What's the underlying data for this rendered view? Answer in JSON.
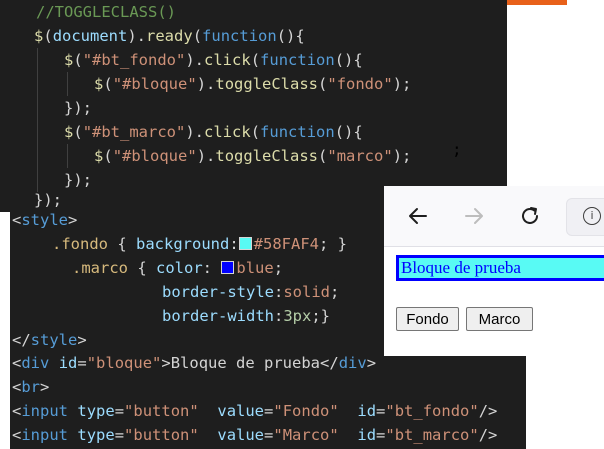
{
  "js_code": {
    "comment": "//TOGGLECLASS()",
    "line1": {
      "a": "$",
      "b": "(",
      "c": "document",
      "d": ").",
      "e": "ready",
      "f": "(",
      "g": "function",
      "h": "(){"
    },
    "line2": {
      "a": "$",
      "b": "(",
      "c": "\"#bt_fondo\"",
      "d": ").",
      "e": "click",
      "f": "(",
      "g": "function",
      "h": "(){"
    },
    "line3": {
      "a": "$",
      "b": "(",
      "c": "\"#bloque\"",
      "d": ").",
      "e": "toggleClass",
      "f": "(",
      "g": "\"fondo\"",
      "h": ");"
    },
    "line4": "});",
    "line5": {
      "a": "$",
      "b": "(",
      "c": "\"#bt_marco\"",
      "d": ").",
      "e": "click",
      "f": "(",
      "g": "function",
      "h": "(){"
    },
    "line6": {
      "a": "$",
      "b": "(",
      "c": "\"#bloque\"",
      "d": ").",
      "e": "toggleClass",
      "f": "(",
      "g": "\"marco\"",
      "h": ");"
    },
    "line7": "});",
    "line8": "});"
  },
  "stray_semicolon": ";",
  "css_code": {
    "open_tag": "style",
    "fondo_sel": ".fondo",
    "fondo_open": " { ",
    "fondo_prop": "background",
    "colon": ":",
    "fondo_val": "#58FAF4",
    "fondo_close": "; }",
    "marco_sel": ".marco",
    "marco_open": " { ",
    "color_prop": "color",
    "color_val": "blue",
    "semi": ";",
    "bstyle_prop": "border-style",
    "bstyle_val": "solid",
    "bwidth_prop": "border-width",
    "bwidth_val": "3px",
    "bwidth_close": ";}",
    "close_tag": "style",
    "swatch_color": "#58FAF4",
    "swatch_blue": "#0000ff"
  },
  "html_code": {
    "div_tag": "div",
    "id_attr": "id",
    "eq": "=",
    "div_id_val": "\"bloque\"",
    "div_text": "Bloque de prueba",
    "br_tag": "br",
    "input_tag": "input",
    "type_attr": "type",
    "type_val": "\"button\"",
    "value_attr": "value",
    "fondo_value": "\"Fondo\"",
    "fondo_id": "\"bt_fondo\"",
    "marco_value": "\"Marco\"",
    "marco_id": "\"bt_marco\""
  },
  "browser": {
    "back_icon": "arrow-left-icon",
    "forward_icon": "arrow-right-icon",
    "reload_icon": "reload-icon",
    "info_icon": "info-icon",
    "info_glyph": "i",
    "bloque_text": "Bloque de prueba",
    "btn_fondo": "Fondo",
    "btn_marco": "Marco"
  },
  "colors": {
    "accent_orange": "#e8611a",
    "bloque_bg": "#58FAF4",
    "bloque_border": "#0000ff"
  }
}
